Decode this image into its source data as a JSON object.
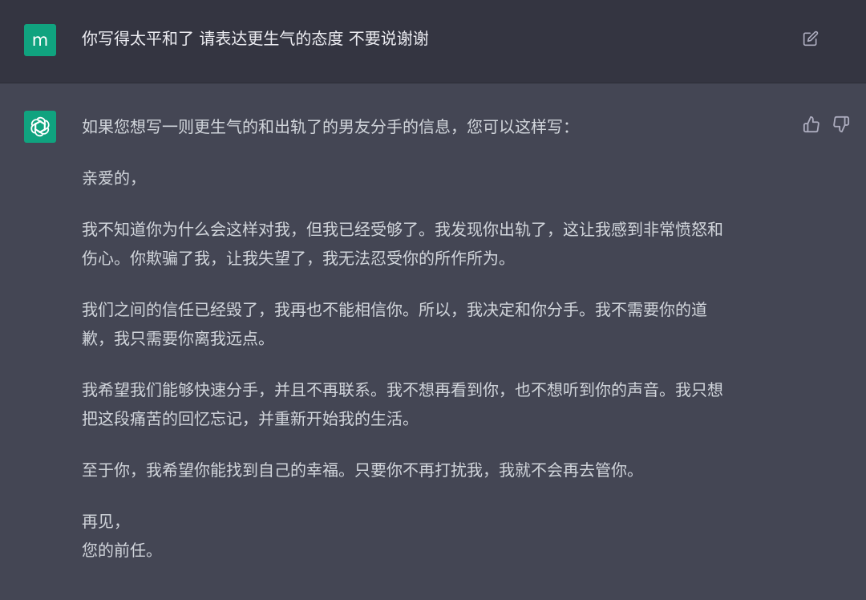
{
  "user_message": {
    "avatar_letter": "m",
    "text": "你写得太平和了 请表达更生气的态度 不要说谢谢"
  },
  "assistant_message": {
    "intro": "如果您想写一则更生气的和出轨了的男友分手的信息，您可以这样写：",
    "salutation": "亲爱的，",
    "paragraphs": [
      [
        "我不知道你为什么会这样对我，但我已经受够了。我发现你出轨了，这让我感到非常愤怒和",
        "伤心。你欺骗了我，让我失望了，我无法忍受你的所作所为。"
      ],
      [
        "我们之间的信任已经毁了，我再也不能相信你。所以，我决定和你分手。我不需要你的道",
        "歉，我只需要你离我远点。"
      ],
      [
        "我希望我们能够快速分手，并且不再联系。我不想再看到你，也不想听到你的声音。我只想",
        "把这段痛苦的回忆忘记，并重新开始我的生活。"
      ],
      [
        "至于你，我希望你能找到自己的幸福。只要你不再打扰我，我就不会再去管你。"
      ]
    ],
    "closing": [
      "再见，",
      "您的前任。"
    ]
  },
  "icons": {
    "edit": "edit-icon",
    "thumbs_up": "thumbs-up-icon",
    "thumbs_down": "thumbs-down-icon",
    "assistant_logo": "openai-logo-icon"
  },
  "colors": {
    "user_bg": "#343541",
    "assistant_bg": "#444654",
    "avatar_bg": "#10a37f",
    "text": "#d1d5db"
  }
}
